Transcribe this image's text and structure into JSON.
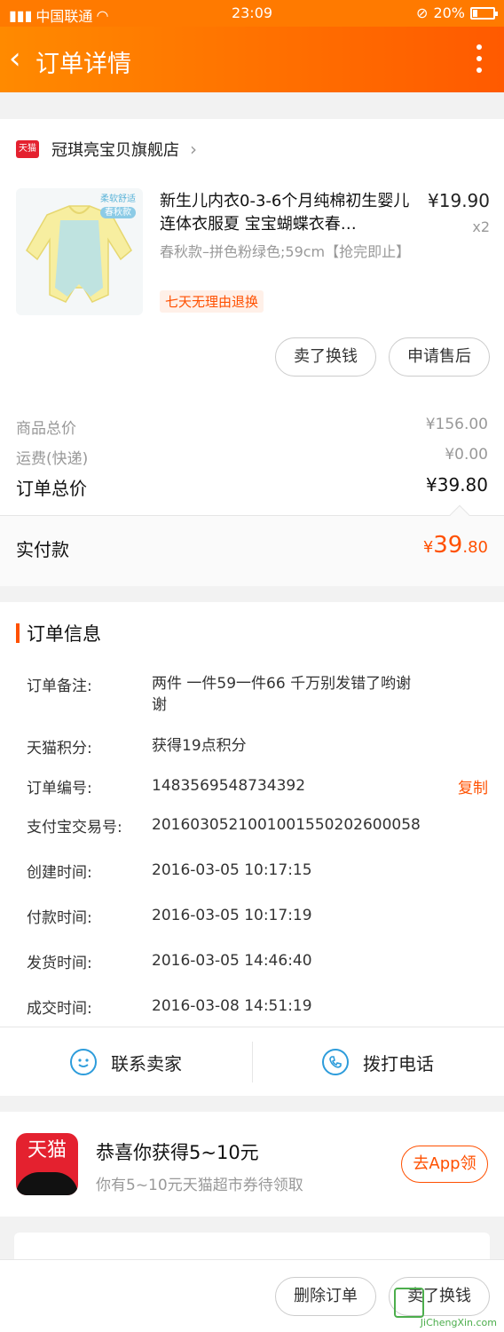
{
  "status_bar": {
    "carrier": "中国联通",
    "time": "23:09",
    "battery": "20%",
    "battery_level": 0.2
  },
  "navbar": {
    "title": "订单详情"
  },
  "shop": {
    "badge": "天猫",
    "name": "冠琪亮宝贝旗舰店"
  },
  "product": {
    "thumb_tag": "柔软舒适",
    "thumb_pill": "春秋款",
    "title": "新生儿内衣0-3-6个月纯棉初生婴儿连体衣服夏 宝宝蝴蝶衣春…",
    "price": "¥19.90",
    "qty": "x2",
    "spec": "春秋款–拼色粉绿色;59cm【抢完即止】",
    "tag": "七天无理由退换"
  },
  "item_actions": {
    "sell": "卖了换钱",
    "aftersale": "申请售后"
  },
  "prices": {
    "goods_label": "商品总价",
    "goods_value": "¥156.00",
    "shipping_label": "运费(快递)",
    "shipping_value": "¥0.00",
    "total_label": "订单总价",
    "total_value": "¥39.80",
    "paid_label": "实付款",
    "paid_symbol": "¥",
    "paid_int": "39",
    "paid_dec": ".80"
  },
  "order_info": {
    "heading": "订单信息",
    "rows": [
      {
        "k": "订单备注:",
        "v": "两件 一件59一件66 千万别发错了哟谢谢"
      },
      {
        "k": "天猫积分:",
        "v": "获得19点积分"
      },
      {
        "k": "订单编号:",
        "v": "1483569548734392",
        "action": "复制"
      },
      {
        "k": "支付宝交易号:",
        "v": "2016030521001001550202600058"
      },
      {
        "k": "创建时间:",
        "v": "2016-03-05 10:17:15"
      },
      {
        "k": "付款时间:",
        "v": "2016-03-05 10:17:19"
      },
      {
        "k": "发货时间:",
        "v": "2016-03-05 14:46:40"
      },
      {
        "k": "成交时间:",
        "v": "2016-03-08 14:51:19"
      }
    ]
  },
  "contact": {
    "seller": "联系卖家",
    "phone": "拨打电话"
  },
  "promo": {
    "logo": "天猫",
    "title": "恭喜你获得5~10元",
    "subtitle": "你有5~10元天猫超市券待领取",
    "button": "去App领"
  },
  "bottom": {
    "delete": "删除订单",
    "sell": "卖了换钱"
  },
  "watermark": "JiChengXin.com"
}
